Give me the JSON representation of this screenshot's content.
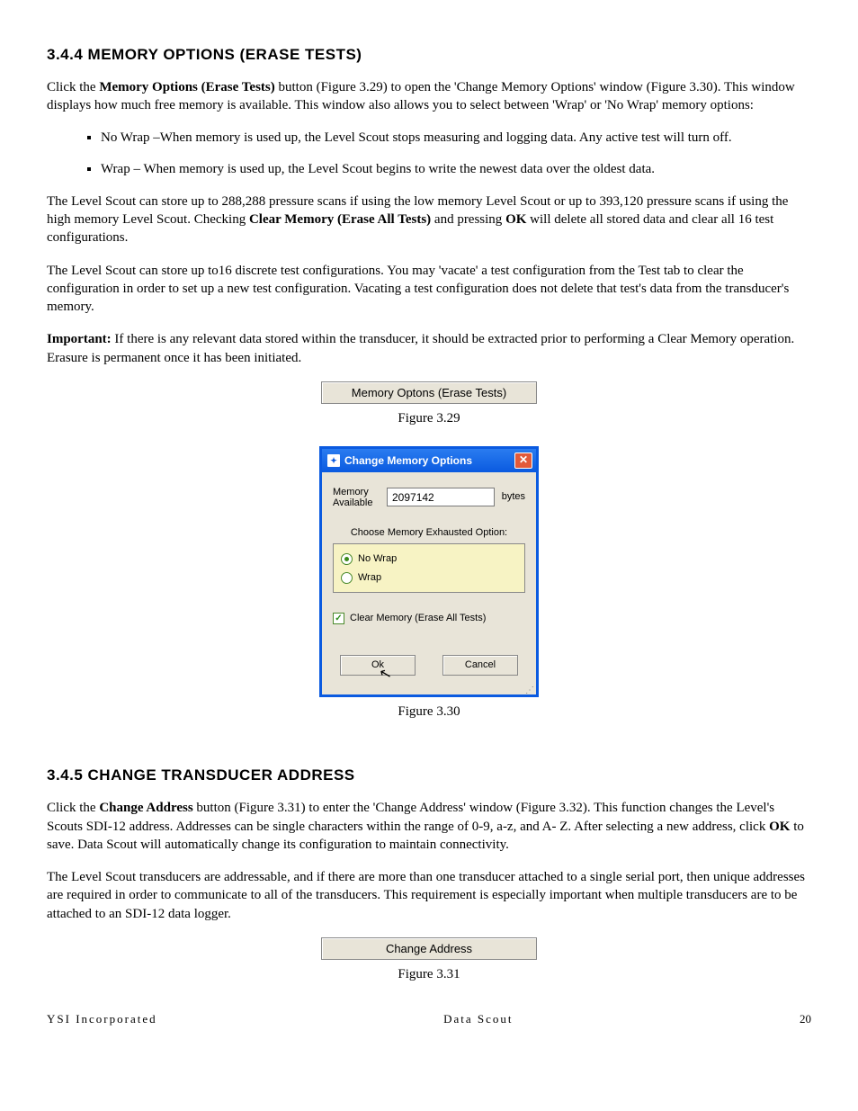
{
  "section344": {
    "heading": "3.4.4 MEMORY OPTIONS (ERASE TESTS)",
    "p1_a": "Click the ",
    "p1_b": "Memory Options (Erase Tests)",
    "p1_c": " button (Figure 3.29) to open the 'Change Memory Options' window (Figure 3.30).  This window displays how much free memory is available.  This window also allows you to select between 'Wrap' or 'No Wrap' memory options:",
    "li1": "No Wrap –When memory is used up, the Level Scout stops measuring and logging data. Any active test will turn off.",
    "li2": "Wrap – When memory is used up, the Level Scout begins to write the newest data over the oldest data.",
    "p2_a": "The Level Scout can store up to 288,288 pressure scans if using the low memory Level Scout or up to 393,120 pressure scans if using the high memory Level Scout.  Checking ",
    "p2_b": "Clear Memory (Erase All Tests)",
    "p2_c": " and pressing ",
    "p2_d": "OK",
    "p2_e": " will delete all stored data and clear all 16 test configurations.",
    "p3": "The Level Scout can store up to16 discrete test configurations. You may 'vacate' a test configuration from the Test tab to clear the configuration in order to set up a new test configuration. Vacating a test configuration does not delete that test's data from the transducer's memory.",
    "p4_a": "Important:",
    "p4_b": "  If there is any relevant data stored within the transducer, it should be extracted prior to performing a Clear Memory operation. Erasure is permanent once it has been initiated."
  },
  "fig329": {
    "button_label": "Memory Optons (Erase Tests)",
    "caption": "Figure 3.29"
  },
  "dialog": {
    "title": "Change Memory Options",
    "mem_label": "Memory Available",
    "mem_value": "2097142",
    "bytes": "bytes",
    "exhausted_label": "Choose Memory Exhausted Option:",
    "opt_nowrap": "No Wrap",
    "opt_wrap": "Wrap",
    "clear_label": "Clear Memory (Erase All Tests)",
    "ok": "Ok",
    "cancel": "Cancel",
    "caption": "Figure 3.30"
  },
  "section345": {
    "heading": "3.4.5 CHANGE TRANSDUCER ADDRESS",
    "p1_a": "Click the ",
    "p1_b": "Change Address",
    "p1_c": " button (Figure 3.31) to enter the 'Change Address' window (Figure 3.32). This function changes the Level's Scouts SDI-12 address. Addresses can be single characters within the range of 0-9, a-z, and A- Z. After selecting a new address, click ",
    "p1_d": "OK",
    "p1_e": " to save. Data Scout will automatically change its configuration to maintain connectivity.",
    "p2": "The Level Scout transducers are addressable, and if there are more than one transducer attached to a single serial port, then unique addresses are required in order to communicate to all of the transducers. This requirement is especially important when multiple transducers are to be attached to an SDI-12 data logger."
  },
  "fig331": {
    "button_label": "Change Address",
    "caption": "Figure 3.31"
  },
  "footer": {
    "left": "YSI Incorporated",
    "mid": "Data Scout",
    "page": "20"
  }
}
